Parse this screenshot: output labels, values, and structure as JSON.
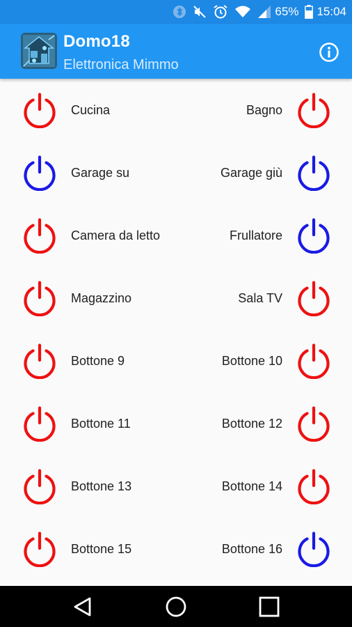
{
  "status_bar": {
    "icons": [
      "bluetooth-icon",
      "mute-icon",
      "alarm-icon",
      "wifi-icon",
      "signal-icon",
      "battery-icon"
    ],
    "battery_percent": "65%",
    "time": "15:04"
  },
  "app_bar": {
    "title": "Domo18",
    "subtitle": "Elettronica Mimmo",
    "info_icon": "info-icon"
  },
  "colors": {
    "status_bar": "#1e88e5",
    "app_bar": "#2196f3",
    "power_off": "#ee1111",
    "power_on": "#1a1ae6",
    "background": "#fafafa"
  },
  "buttons": [
    {
      "label": "Cucina",
      "state": "off"
    },
    {
      "label": "Bagno",
      "state": "off"
    },
    {
      "label": "Garage su",
      "state": "on"
    },
    {
      "label": "Garage giù",
      "state": "on"
    },
    {
      "label": "Camera da letto",
      "state": "off"
    },
    {
      "label": "Frullatore",
      "state": "on"
    },
    {
      "label": "Magazzino",
      "state": "off"
    },
    {
      "label": "Sala TV",
      "state": "off"
    },
    {
      "label": "Bottone 9",
      "state": "off"
    },
    {
      "label": "Bottone 10",
      "state": "off"
    },
    {
      "label": "Bottone 11",
      "state": "off"
    },
    {
      "label": "Bottone 12",
      "state": "off"
    },
    {
      "label": "Bottone 13",
      "state": "off"
    },
    {
      "label": "Bottone 14",
      "state": "off"
    },
    {
      "label": "Bottone 15",
      "state": "off"
    },
    {
      "label": "Bottone 16",
      "state": "on"
    }
  ],
  "nav_bar": {
    "icons": [
      "back-icon",
      "home-icon",
      "recents-icon"
    ]
  }
}
